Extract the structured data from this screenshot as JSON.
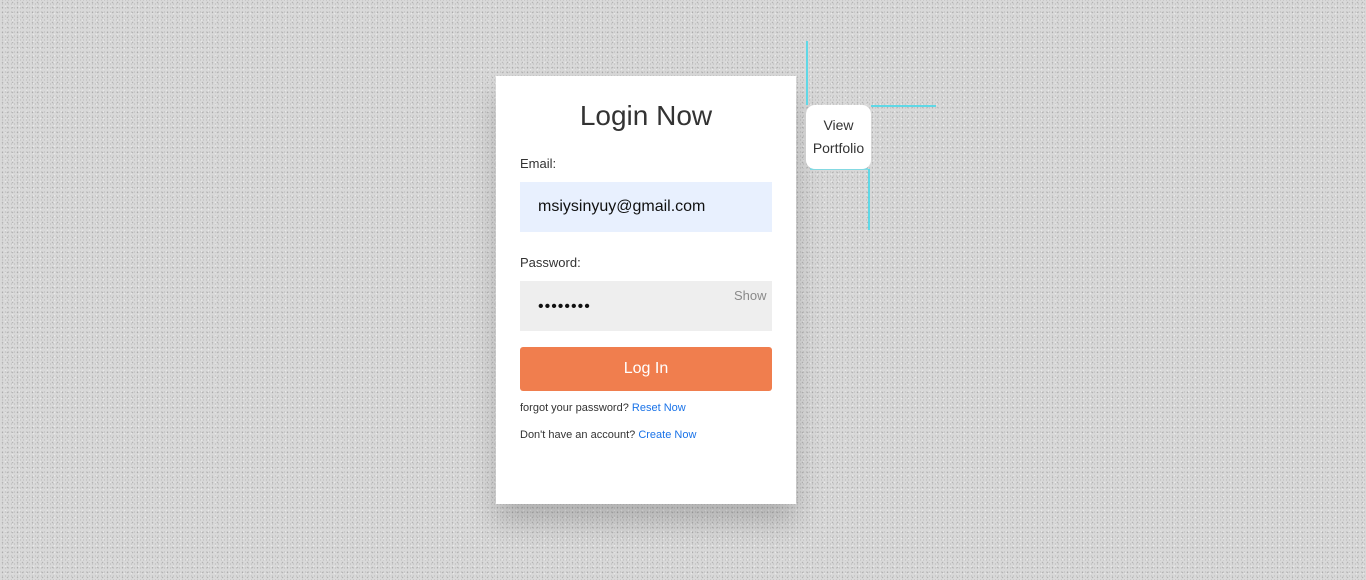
{
  "login": {
    "title": "Login Now",
    "email_label": "Email:",
    "email_value": "msiysinyuy@gmail.com",
    "password_label": "Password:",
    "password_value": "••••••••",
    "show_label": "Show",
    "login_button": "Log In",
    "forgot_text": "forgot your password?",
    "reset_link": "Reset Now",
    "no_account_text": "Don't have an account?",
    "create_link": "Create Now"
  },
  "portfolio": {
    "line1": "View",
    "line2": "Portfolio"
  },
  "colors": {
    "accent": "#f07e4e",
    "link": "#1a73e8",
    "decor_line": "#5fd8e6",
    "email_bg": "#e8f0fe"
  }
}
